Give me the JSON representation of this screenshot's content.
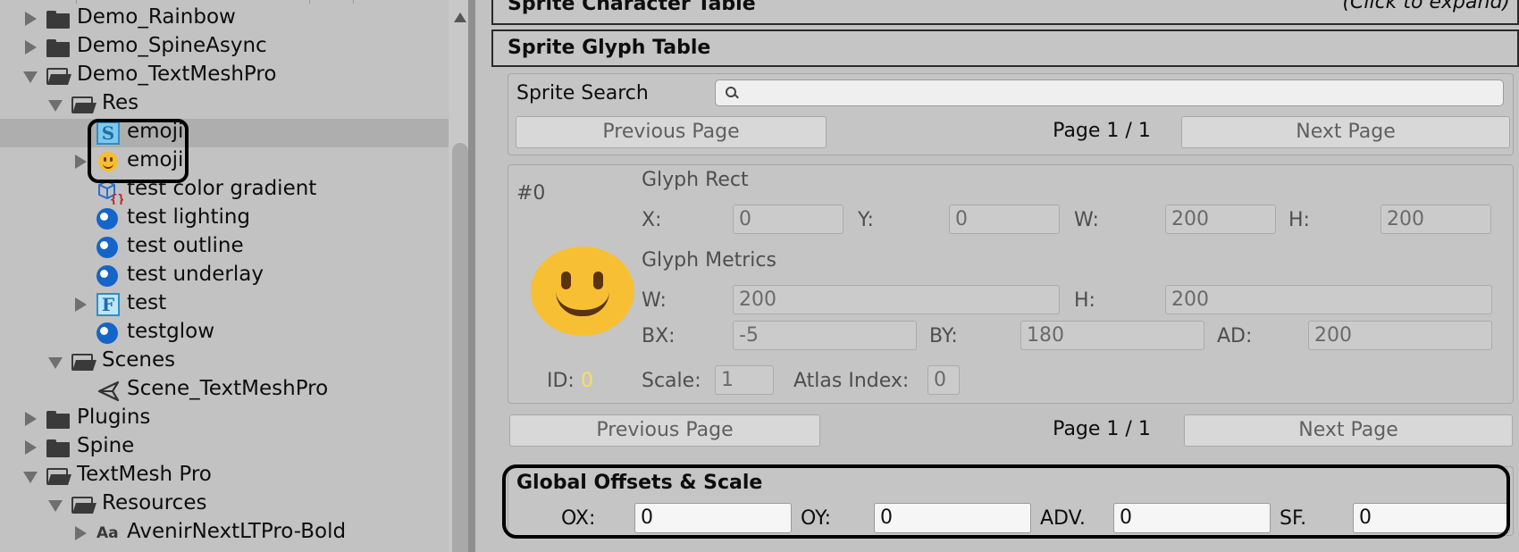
{
  "tree": {
    "items": [
      {
        "label": "Demo_Rainbow",
        "icon": "folder-icon"
      },
      {
        "label": "Demo_SpineAsync",
        "icon": "folder-icon"
      },
      {
        "label": "Demo_TextMeshPro",
        "icon": "open-folder-icon"
      },
      {
        "label": "Res",
        "icon": "open-folder-icon"
      },
      {
        "label": "emoji",
        "icon": "sprite-asset-icon"
      },
      {
        "label": "emoji",
        "icon": "emoji-texture-icon"
      },
      {
        "label": "test color gradient",
        "icon": "color-gradient-icon"
      },
      {
        "label": "test lighting",
        "icon": "material-icon"
      },
      {
        "label": "test outline",
        "icon": "material-icon"
      },
      {
        "label": "test underlay",
        "icon": "material-icon"
      },
      {
        "label": "test",
        "icon": "font-asset-icon"
      },
      {
        "label": "testglow",
        "icon": "material-icon"
      },
      {
        "label": "Scenes",
        "icon": "open-folder-icon"
      },
      {
        "label": "Scene_TextMeshPro",
        "icon": "unity-scene-icon"
      },
      {
        "label": "Plugins",
        "icon": "folder-icon"
      },
      {
        "label": "Spine",
        "icon": "folder-icon"
      },
      {
        "label": "TextMesh Pro",
        "icon": "open-folder-icon"
      },
      {
        "label": "Resources",
        "icon": "open-folder-icon"
      },
      {
        "label": "AvenirNextLTPro-Bold",
        "icon": "font-aa-icon"
      }
    ]
  },
  "inspector": {
    "sprite_character_table": {
      "title": "Sprite Character Table",
      "hint": "(Click to expand)"
    },
    "sprite_glyph_table": {
      "title": "Sprite Glyph Table"
    },
    "search": {
      "label": "Sprite Search",
      "placeholder": ""
    },
    "pager_top": {
      "prev": "Previous Page",
      "page": "Page 1 / 1",
      "next": "Next Page"
    },
    "glyph": {
      "index": "#0",
      "rect_title": "Glyph Rect",
      "rect": {
        "x_label": "X:",
        "x": "0",
        "y_label": "Y:",
        "y": "0",
        "w_label": "W:",
        "w": "200",
        "h_label": "H:",
        "h": "200"
      },
      "metrics_title": "Glyph Metrics",
      "metrics": {
        "w_label": "W:",
        "w": "200",
        "h_label": "H:",
        "h": "200",
        "bx_label": "BX:",
        "bx": "-5",
        "by_label": "BY:",
        "by": "180",
        "ad_label": "AD:",
        "ad": "200"
      },
      "id_label": "ID:",
      "id": "0",
      "scale_label": "Scale:",
      "scale": "1",
      "atlas_label": "Atlas Index:",
      "atlas": "0"
    },
    "pager_bottom": {
      "prev": "Previous Page",
      "page": "Page 1 / 1",
      "next": "Next Page"
    },
    "global": {
      "title": "Global Offsets & Scale",
      "ox_label": "OX:",
      "ox": "0",
      "oy_label": "OY:",
      "oy": "0",
      "adv_label": "ADV.",
      "adv": "0",
      "sf_label": "SF.",
      "sf": "0"
    }
  },
  "colors": {
    "id_value": "#f4e15a",
    "background": "#c2c2c2",
    "highlight_outline": "#000000"
  }
}
